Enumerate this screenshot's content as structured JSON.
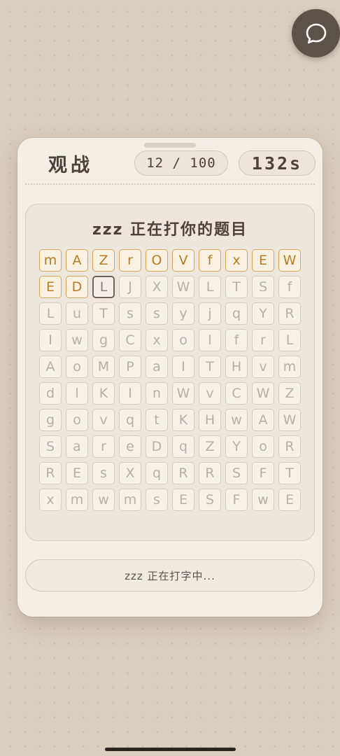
{
  "header": {
    "title": "观战",
    "progress": "12 / 100",
    "timer": "132s"
  },
  "puzzle": {
    "title": "zzz 正在打你的题目",
    "typed_count": 12,
    "cursor_index": 12,
    "rows": [
      [
        "m",
        "A",
        "Z",
        "r",
        "O",
        "V",
        "f",
        "x",
        "E",
        "W"
      ],
      [
        "E",
        "D",
        "L",
        "J",
        "X",
        "W",
        "L",
        "T",
        "S",
        "f"
      ],
      [
        "L",
        "u",
        "T",
        "s",
        "s",
        "y",
        "j",
        "q",
        "Y",
        "R"
      ],
      [
        "I",
        "w",
        "g",
        "C",
        "x",
        "o",
        "l",
        "f",
        "r",
        "L"
      ],
      [
        "A",
        "o",
        "M",
        "P",
        "a",
        "I",
        "T",
        "H",
        "v",
        "m"
      ],
      [
        "d",
        "l",
        "K",
        "I",
        "n",
        "W",
        "v",
        "C",
        "W",
        "Z"
      ],
      [
        "g",
        "o",
        "v",
        "q",
        "t",
        "K",
        "H",
        "w",
        "A",
        "W"
      ],
      [
        "S",
        "a",
        "r",
        "e",
        "D",
        "q",
        "Z",
        "Y",
        "o",
        "R"
      ],
      [
        "R",
        "E",
        "s",
        "X",
        "q",
        "R",
        "R",
        "S",
        "F",
        "T"
      ],
      [
        "x",
        "m",
        "w",
        "m",
        "s",
        "E",
        "S",
        "F",
        "w",
        "E"
      ]
    ]
  },
  "status": {
    "text": "zzz 正在打字中..."
  },
  "icons": {
    "chat": "chat-bubble-icon"
  },
  "colors": {
    "typed_accent": "#d7a553",
    "typed_text": "#b77d24",
    "cursor_border": "#6d655c",
    "pending_text": "#b8afa3",
    "background": "#d9cfc1",
    "card": "#f4efe6"
  }
}
